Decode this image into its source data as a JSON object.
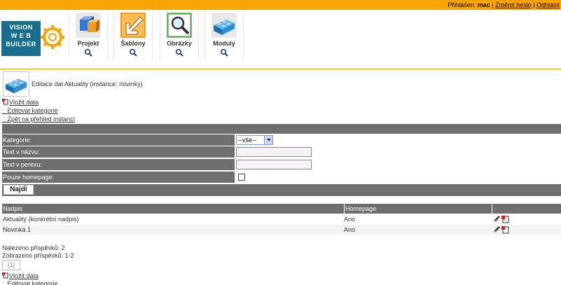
{
  "topbar": {
    "logged_in_label": "Přihlášen:",
    "username": "mac",
    "change_password": "Změnit heslo",
    "logout": "Odhlásit"
  },
  "logo": {
    "line1": "VISION",
    "line2": "W E B",
    "line3": "BUILDER"
  },
  "modules": [
    {
      "label": "Projekt",
      "icon": "cubes-icon"
    },
    {
      "label": "Šablony",
      "icon": "arrow-down-left-icon"
    },
    {
      "label": "Obrázky",
      "icon": "image-zoom-icon"
    },
    {
      "label": "Moduly",
      "icon": "lego-brick-icon"
    }
  ],
  "page": {
    "title": "Editace dat Aktuality (instance: novinky)"
  },
  "actions": {
    "insert": "Vložit data",
    "edit_categories": "Editovat kategorie",
    "back": "Zpět na přehled instancí"
  },
  "filter": {
    "category_label": "Kategorie:",
    "category_value": "--vše--",
    "title_label": "Text v názvu:",
    "title_value": "",
    "perex_label": "Text v perexu:",
    "perex_value": "",
    "homepage_label": "Pouze homepage:",
    "find_button": "Najdi"
  },
  "table": {
    "columns": [
      "Nadpis",
      "Homepage",
      ""
    ],
    "rows": [
      {
        "title": "Aktuality (konkrétní nadpis)",
        "homepage": "Ano"
      },
      {
        "title": "Novinka 1",
        "homepage": "Ano"
      }
    ]
  },
  "summary": {
    "found": "Nalezeno příspěvků: 2",
    "shown": "Zobrazeno příspěvků: 1-2",
    "page_button": "[1]"
  },
  "colors": {
    "accent": "#f7a400",
    "bar": "#6e6e6e",
    "logo": "#1a6f8e"
  }
}
